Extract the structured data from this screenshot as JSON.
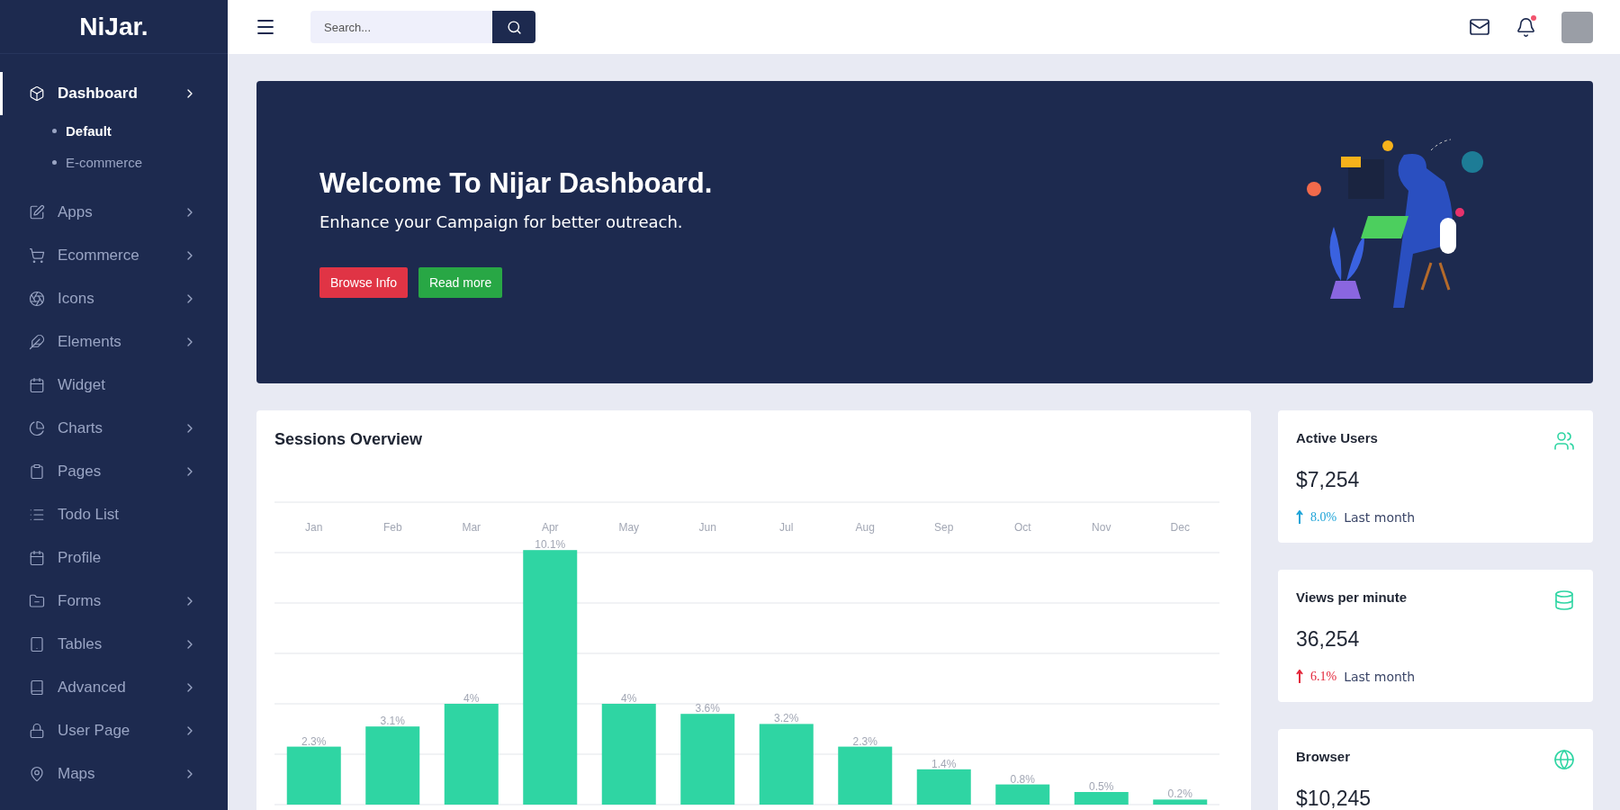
{
  "brand": {
    "logo": "NiJar."
  },
  "sidebar": {
    "items": [
      {
        "label": "Dashboard",
        "selected": true,
        "has_arrow": true,
        "children": [
          {
            "label": "Default",
            "selected": true
          },
          {
            "label": "E-commerce",
            "selected": false
          }
        ]
      },
      {
        "label": "Apps",
        "selected": false,
        "has_arrow": true
      },
      {
        "label": "Ecommerce",
        "selected": false,
        "has_arrow": true
      },
      {
        "label": "Icons",
        "selected": false,
        "has_arrow": true
      },
      {
        "label": "Elements",
        "selected": false,
        "has_arrow": true
      },
      {
        "label": "Widget",
        "selected": false,
        "has_arrow": false
      },
      {
        "label": "Charts",
        "selected": false,
        "has_arrow": true
      },
      {
        "label": "Pages",
        "selected": false,
        "has_arrow": true
      },
      {
        "label": "Todo List",
        "selected": false,
        "has_arrow": false
      },
      {
        "label": "Profile",
        "selected": false,
        "has_arrow": false
      },
      {
        "label": "Forms",
        "selected": false,
        "has_arrow": true
      },
      {
        "label": "Tables",
        "selected": false,
        "has_arrow": true
      },
      {
        "label": "Advanced",
        "selected": false,
        "has_arrow": true
      },
      {
        "label": "User Page",
        "selected": false,
        "has_arrow": true
      },
      {
        "label": "Maps",
        "selected": false,
        "has_arrow": true
      }
    ]
  },
  "header": {
    "search": {
      "placeholder": "Search..."
    },
    "notification_dot": true
  },
  "banner": {
    "title": "Welcome To Nijar Dashboard.",
    "subtitle": "Enhance your Campaign for better outreach.",
    "buttons": [
      {
        "label": "Browse Info",
        "kind": "danger"
      },
      {
        "label": "Read more",
        "kind": "success"
      }
    ]
  },
  "sessions": {
    "title": "Sessions Overview",
    "chart_data": {
      "type": "bar",
      "categories": [
        "Jan",
        "Feb",
        "Mar",
        "Apr",
        "May",
        "Jun",
        "Jul",
        "Aug",
        "Sep",
        "Oct",
        "Nov",
        "Dec"
      ],
      "series": [
        {
          "color": "#2fd5a3",
          "values": [
            2.3,
            3.1,
            4,
            10.1,
            4,
            3.6,
            3.2,
            2.3,
            1.4,
            0.8,
            0.5,
            0.2
          ],
          "value_labels": [
            "2.3%",
            "3.1%",
            "4%",
            "10.1%",
            "4%",
            "3.6%",
            "3.2%",
            "2.3%",
            "1.4%",
            "0.8%",
            "0.5%",
            "0.2%"
          ]
        }
      ]
    }
  },
  "stats": [
    {
      "title": "Active Users",
      "value": "$7,254",
      "change": "8.0%",
      "color": "#1ea4d8",
      "note": "Last month"
    },
    {
      "title": "Views per minute",
      "value": "36,254",
      "change": "6.1%",
      "color": "#e3263a",
      "note": "Last month"
    },
    {
      "title": "Browser",
      "value": "$10,245"
    }
  ]
}
